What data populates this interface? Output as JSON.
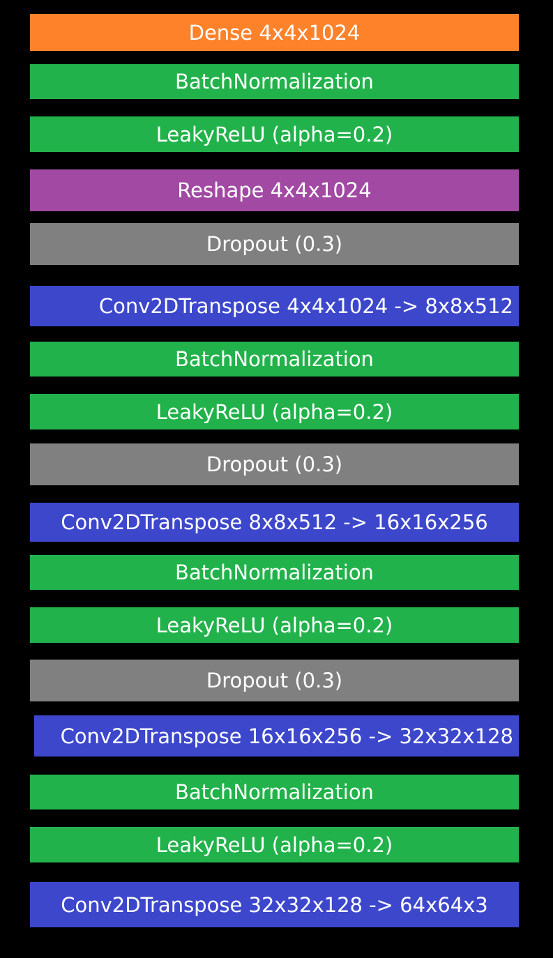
{
  "layers": [
    {
      "label": "Dense 4x4x1024",
      "kind": "dense",
      "color": "#fd822a"
    },
    {
      "label": "BatchNormalization",
      "kind": "batchnorm",
      "color": "#22b24b"
    },
    {
      "label": "LeakyReLU (alpha=0.2)",
      "kind": "leakyrelu",
      "color": "#22b24b"
    },
    {
      "label": "Reshape 4x4x1024",
      "kind": "reshape",
      "color": "#a149a3"
    },
    {
      "label": "Dropout (0.3)",
      "kind": "dropout",
      "color": "#808080"
    },
    {
      "label": "Conv2DTranspose 4x4x1024 -> 8x8x512",
      "kind": "conv2dtranspose",
      "color": "#3d47cc"
    },
    {
      "label": "BatchNormalization",
      "kind": "batchnorm",
      "color": "#22b24b"
    },
    {
      "label": "LeakyReLU (alpha=0.2)",
      "kind": "leakyrelu",
      "color": "#22b24b"
    },
    {
      "label": "Dropout (0.3)",
      "kind": "dropout",
      "color": "#808080"
    },
    {
      "label": "Conv2DTranspose 8x8x512 -> 16x16x256",
      "kind": "conv2dtranspose",
      "color": "#3d47cc"
    },
    {
      "label": "BatchNormalization",
      "kind": "batchnorm",
      "color": "#22b24b"
    },
    {
      "label": "LeakyReLU (alpha=0.2)",
      "kind": "leakyrelu",
      "color": "#22b24b"
    },
    {
      "label": "Dropout (0.3)",
      "kind": "dropout",
      "color": "#808080"
    },
    {
      "label": "Conv2DTranspose 16x16x256 -> 32x32x128",
      "kind": "conv2dtranspose",
      "color": "#3d47cc"
    },
    {
      "label": "BatchNormalization",
      "kind": "batchnorm",
      "color": "#22b24b"
    },
    {
      "label": "LeakyReLU (alpha=0.2)",
      "kind": "leakyrelu",
      "color": "#22b24b"
    },
    {
      "label": "Conv2DTranspose 32x32x128 -> 64x64x3",
      "kind": "conv2dtranspose",
      "color": "#3d47cc"
    }
  ],
  "background_color": "#000000",
  "text_color": "#ffffff"
}
